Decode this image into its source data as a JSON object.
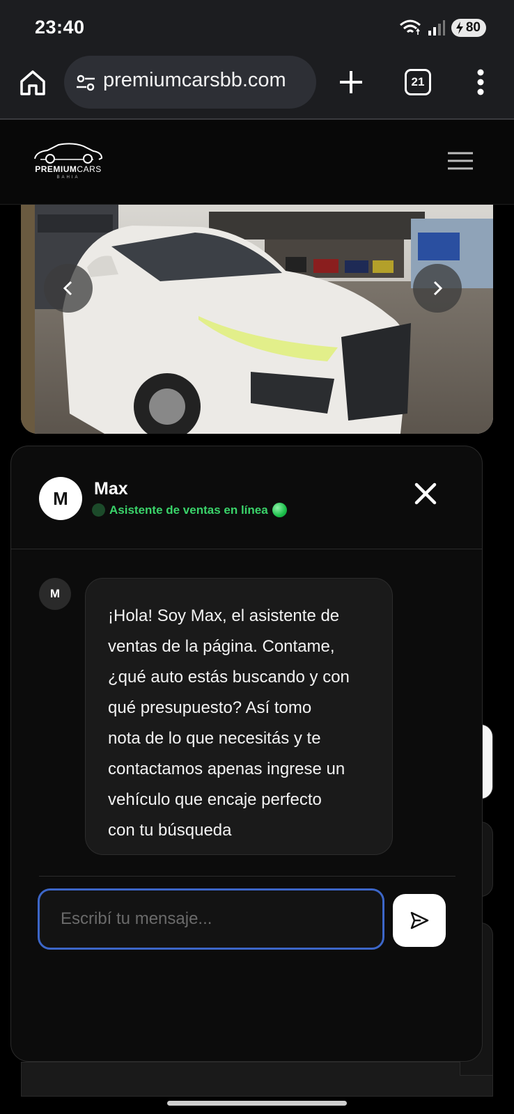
{
  "status_bar": {
    "time": "23:40",
    "battery_level": "80",
    "icons": [
      "wifi-icon",
      "signal-icon",
      "battery-charging-icon"
    ]
  },
  "browser": {
    "url": "premiumcarsbb.com",
    "tab_count": "21",
    "icons": [
      "home-icon",
      "site-settings-icon",
      "new-tab-icon",
      "tab-switcher-icon",
      "more-menu-icon"
    ]
  },
  "site": {
    "logo_text_primary": "PREMIUM",
    "logo_text_secondary": "CARS",
    "logo_subtext": "BAHIA",
    "menu_icon": "hamburger-icon"
  },
  "carousel": {
    "photo_description_icon": "car-photo",
    "prev_icon": "chevron-left-icon",
    "next_icon": "chevron-right-icon"
  },
  "chat": {
    "agent_initial": "M",
    "agent_name": "Max",
    "agent_status": "Asistente de ventas en línea",
    "messages": [
      {
        "sender_initial": "M",
        "lines": [
          "¡Hola! Soy Max, el asistente de",
          "ventas de la página. Contame,",
          "¿qué auto estás buscando y con",
          "qué presupuesto? Así tomo",
          "nota de lo que necesitás y te",
          "contactamos apenas ingrese un",
          "vehículo que encaje perfecto",
          "con tu búsqueda"
        ]
      }
    ],
    "input_placeholder": "Escribí tu mensaje...",
    "input_value": "",
    "colors": {
      "accent_border": "#3c66c8",
      "status_green": "#3ad36a"
    }
  }
}
